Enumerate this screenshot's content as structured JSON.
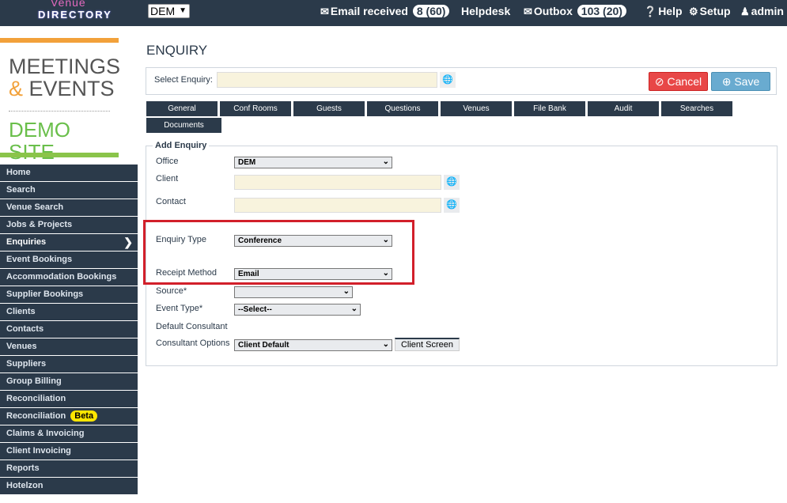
{
  "topbar": {
    "logo_line1": "Venue",
    "logo_line2": "DIRECTORY",
    "office": "DEM",
    "email_received_label": "Email received",
    "email_received_count": "8 (60)",
    "helpdesk": "Helpdesk",
    "outbox_label": "Outbox",
    "outbox_count": "103 (20)",
    "help": "Help",
    "setup": "Setup",
    "user": "admin"
  },
  "brand": {
    "meetings": "MEETINGS",
    "amp": "&",
    "events": "EVENTS",
    "demo": "DEMO SITE"
  },
  "sidebar": {
    "items": [
      {
        "label": "Home"
      },
      {
        "label": "Search"
      },
      {
        "label": "Venue Search"
      },
      {
        "label": "Jobs & Projects"
      },
      {
        "label": "Enquiries"
      },
      {
        "label": "Event Bookings"
      },
      {
        "label": "Accommodation Bookings"
      },
      {
        "label": "Supplier Bookings"
      },
      {
        "label": "Clients"
      },
      {
        "label": "Contacts"
      },
      {
        "label": "Venues"
      },
      {
        "label": "Suppliers"
      },
      {
        "label": "Group Billing"
      },
      {
        "label": "Reconciliation"
      },
      {
        "label": "Reconciliation",
        "badge": "Beta"
      },
      {
        "label": "Claims & Invoicing"
      },
      {
        "label": "Client Invoicing"
      },
      {
        "label": "Reports"
      },
      {
        "label": "Hotelzon"
      }
    ]
  },
  "main": {
    "title": "ENQUIRY",
    "select_enquiry_label": "Select Enquiry:",
    "cancel_label": "Cancel",
    "save_label": "Save",
    "tabs": [
      "General",
      "Conf Rooms",
      "Guests",
      "Questions",
      "Venues",
      "File Bank",
      "Audit",
      "Searches",
      "Documents"
    ],
    "form": {
      "legend": "Add Enquiry",
      "office_label": "Office",
      "office_value": "DEM",
      "client_label": "Client",
      "contact_label": "Contact",
      "enquiry_type_label": "Enquiry Type",
      "enquiry_type_value": "Conference",
      "receipt_method_label": "Receipt Method",
      "receipt_method_value": "Email",
      "source_label": "Source*",
      "source_value": "",
      "event_type_label": "Event Type*",
      "event_type_value": "--Select--",
      "default_consultant_label": "Default Consultant",
      "consultant_options_label": "Consultant Options",
      "consultant_options_value": "Client Default",
      "client_screen_label": "Client Screen"
    }
  },
  "colors": {
    "navy": "#2b3a4a",
    "orange": "#f2a13a",
    "green": "#6abf4b",
    "cancel": "#e84747",
    "save": "#69abd0",
    "highlight": "#d21f2a"
  }
}
